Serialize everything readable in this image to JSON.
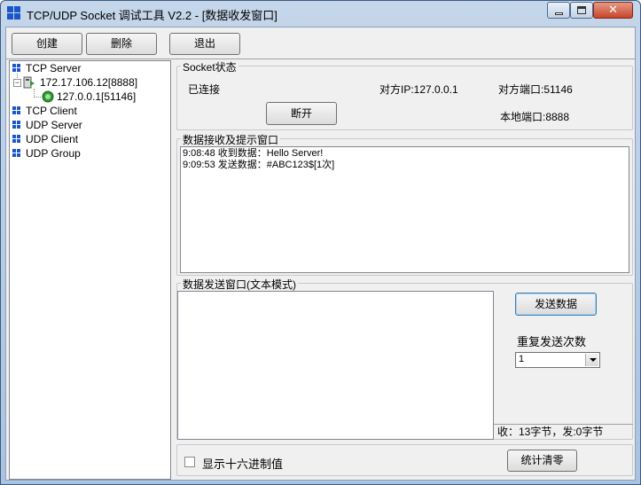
{
  "window": {
    "title": "TCP/UDP Socket 调试工具 V2.2 - [数据收发窗口]",
    "min_glyph": "",
    "close_glyph": "✕"
  },
  "toolbar": {
    "create_label": "创建",
    "delete_label": "删除",
    "exit_label": "退出"
  },
  "tree": {
    "tcp_server": "TCP Server",
    "server_node": "172.17.106.12[8888]",
    "client_node": "127.0.0.1[51146]",
    "tcp_client": "TCP Client",
    "udp_server": "UDP Server",
    "udp_client": "UDP Client",
    "udp_group": "UDP Group",
    "expander_symbol": "−"
  },
  "socket": {
    "group_title": "Socket状态",
    "status": "已连接",
    "remote_ip": "对方IP:127.0.0.1",
    "remote_port": "对方端口:51146",
    "local_port": "本地端口:8888",
    "disconnect_label": "断开"
  },
  "receive": {
    "group_title": "数据接收及提示窗口",
    "lines": [
      "9:08:48 收到数据：Hello Server!",
      "9:09:53 发送数据：#ABC123$[1次]"
    ]
  },
  "send": {
    "group_title": "数据发送窗口(文本模式)",
    "text": "",
    "send_label": "发送数据",
    "repeat_label": "重复发送次数",
    "repeat_value": "1",
    "stats": "收：13字节，发:0字节"
  },
  "bottom": {
    "hex_label": "显示十六进制值",
    "hex_checked": false,
    "reset_label": "统计清零"
  },
  "colors": {
    "accent": "#1a56c9",
    "status_dot": "#2e9a2e"
  }
}
